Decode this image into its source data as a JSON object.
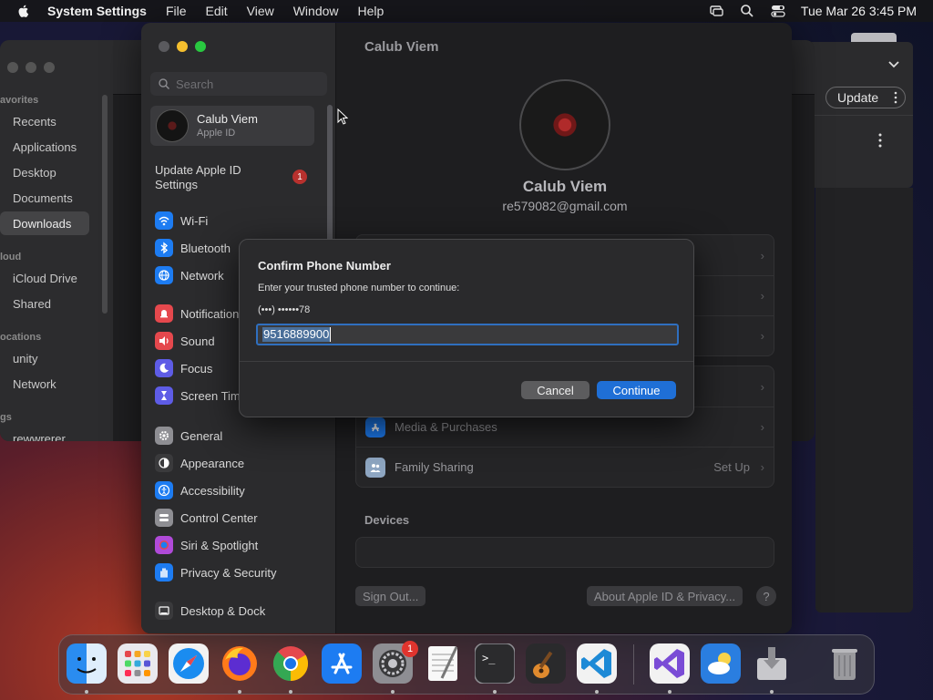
{
  "menubar": {
    "app": "System Settings",
    "items": [
      "File",
      "Edit",
      "Window",
      "Help"
    ],
    "view": "View",
    "clock": "Tue Mar 26  3:45 PM"
  },
  "finder": {
    "sections": [
      "avorites",
      "loud",
      "ocations",
      "gs"
    ],
    "items": [
      "Recents",
      "Applications",
      "Desktop",
      "Documents",
      "Downloads",
      "iCloud Drive",
      "Shared",
      "unity",
      "Network",
      "rewwrerer"
    ]
  },
  "rightwin": {
    "update_label": "Update"
  },
  "settings": {
    "search_placeholder": "Search",
    "account": {
      "name": "Calub Viem",
      "sub": "Apple ID"
    },
    "update_notice": "Update Apple ID Settings",
    "update_badge": "1",
    "sidebar": [
      {
        "label": "Wi-Fi",
        "icon": "wifi-icon",
        "color": "#1d7cf2"
      },
      {
        "label": "Bluetooth",
        "icon": "bluetooth-icon",
        "color": "#1d7cf2"
      },
      {
        "label": "Network",
        "icon": "globe-icon",
        "color": "#1d7cf2"
      },
      {
        "label": "Notifications",
        "icon": "bell-icon",
        "color": "#e5484d"
      },
      {
        "label": "Sound",
        "icon": "speaker-icon",
        "color": "#e5484d"
      },
      {
        "label": "Focus",
        "icon": "moon-icon",
        "color": "#5e5ce6"
      },
      {
        "label": "Screen Time",
        "icon": "hourglass-icon",
        "color": "#5e5ce6"
      },
      {
        "label": "General",
        "icon": "gear-icon",
        "color": "#8e8e93"
      },
      {
        "label": "Appearance",
        "icon": "appearance-icon",
        "color": "#3a3a3c"
      },
      {
        "label": "Accessibility",
        "icon": "accessibility-icon",
        "color": "#1d7cf2"
      },
      {
        "label": "Control Center",
        "icon": "control-center-icon",
        "color": "#8e8e93"
      },
      {
        "label": "Siri & Spotlight",
        "icon": "siri-icon",
        "color": "#b04ad8"
      },
      {
        "label": "Privacy & Security",
        "icon": "hand-icon",
        "color": "#1d7cf2"
      },
      {
        "label": "Desktop & Dock",
        "icon": "dock-icon",
        "color": "#3a3a3c"
      }
    ],
    "content": {
      "title": "Calub Viem",
      "name": "Calub Viem",
      "email": "re579082@gmail.com",
      "media": "Media & Purchases",
      "family": "Family Sharing",
      "family_action": "Set Up",
      "devices": "Devices",
      "sign_out": "Sign Out...",
      "about": "About Apple ID & Privacy...",
      "help": "?"
    }
  },
  "modal": {
    "title": "Confirm Phone Number",
    "description": "Enter your trusted phone number to continue:",
    "phone_hint": "(•••) ••••••78",
    "input_value": "9516889900",
    "cancel": "Cancel",
    "continue": "Continue"
  },
  "dock": {
    "apps": [
      "finder-icon",
      "launchpad-icon",
      "safari-icon",
      "firefox-icon",
      "chrome-icon",
      "app-store-icon",
      "system-settings-icon",
      "textedit-icon",
      "terminal-icon",
      "garageband-icon",
      "vscode-icon",
      "visual-studio-icon",
      "weather-icon",
      "installer-icon",
      "trash-icon"
    ],
    "settings_badge": "1"
  }
}
